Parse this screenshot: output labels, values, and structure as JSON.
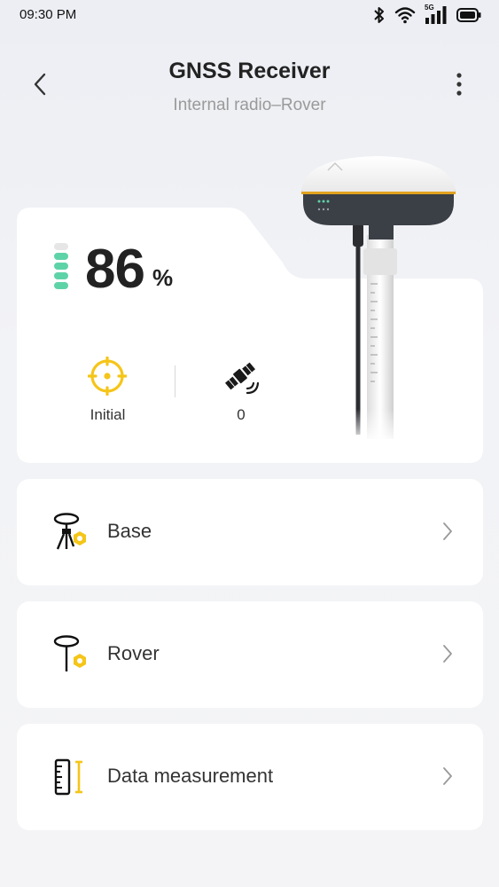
{
  "status_bar": {
    "time": "09:30 PM",
    "network_label": "5G",
    "icons": [
      "bluetooth-icon",
      "wifi-icon",
      "signal-5g-icon",
      "battery-icon"
    ]
  },
  "header": {
    "title": "GNSS Receiver",
    "subtitle": "Internal radio–Rover",
    "back_icon": "chevron-left-icon",
    "more_icon": "more-vertical-icon"
  },
  "status_card": {
    "battery_value": "86",
    "battery_unit": "%",
    "battery_level": 0.86,
    "fix_status": "Initial",
    "satellite_count": "0",
    "colors": {
      "accent": "#f5c518",
      "battery": "#5fd3a8"
    }
  },
  "menu": {
    "items": [
      {
        "label": "Base",
        "icon": "base-station-icon"
      },
      {
        "label": "Rover",
        "icon": "rover-icon"
      },
      {
        "label": "Data measurement",
        "icon": "data-measurement-icon"
      }
    ]
  }
}
